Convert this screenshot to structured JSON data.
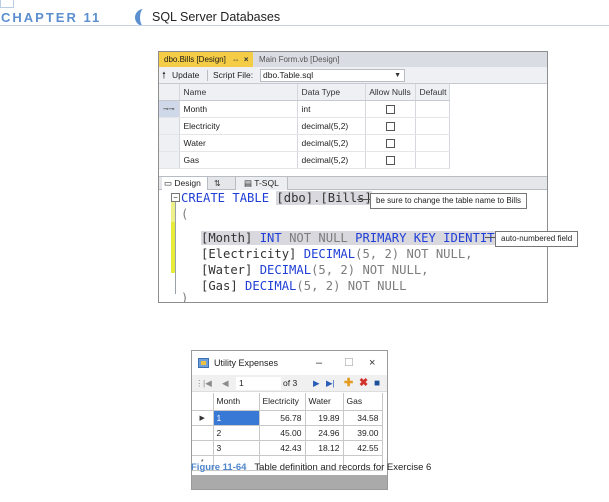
{
  "chapter": {
    "label": "CHAPTER 11",
    "title": "SQL Server Databases"
  },
  "designer": {
    "active_tab": "dbo.Bills [Design]",
    "active_tab_pin": "⇔",
    "active_tab_close": "×",
    "inactive_tab": "Main Form.vb [Design]",
    "toolbar": {
      "update": "Update",
      "script_file_label": "Script File:",
      "script_file_value": "dbo.Table.sql"
    },
    "columns_header": [
      "Name",
      "Data Type",
      "Allow Nulls",
      "Default"
    ],
    "rows": [
      {
        "name": "Month",
        "type": "int",
        "key": true
      },
      {
        "name": "Electricity",
        "type": "decimal(5,2)",
        "key": false
      },
      {
        "name": "Water",
        "type": "decimal(5,2)",
        "key": false
      },
      {
        "name": "Gas",
        "type": "decimal(5,2)",
        "key": false
      }
    ],
    "panel_tabs": {
      "design": "Design",
      "swap": "⇅",
      "tsql": "T-SQL"
    },
    "code": {
      "l1_kw": "CREATE TABLE ",
      "l1_name": "[dbo].[Bills]",
      "l2": "(",
      "l3_a": "[Month] ",
      "l3_b": "INT ",
      "l3_c": "NOT NULL ",
      "l3_d": "PRIMARY KEY IDENTITY",
      "l3_e": ",",
      "l4_a": "[Electricity] ",
      "l4_b": "DECIMAL",
      "l4_c": "(5, 2) ",
      "l4_d": "NOT NULL,",
      "l5_a": "[Water] ",
      "l5_b": "DECIMAL",
      "l5_c": "(5, 2) ",
      "l5_d": "NOT NULL,",
      "l6_a": "[Gas] ",
      "l6_b": "DECIMAL",
      "l6_c": "(5, 2) ",
      "l6_d": "NOT NULL",
      "l7": ")"
    },
    "callouts": {
      "rename": "be sure to change the table name to Bills",
      "identity": "auto-numbered field"
    }
  },
  "form": {
    "title": "Utility Expenses",
    "window_buttons": {
      "minimize": "–",
      "maximize": "☐",
      "close": "×"
    },
    "navigator": {
      "position": "1",
      "of_count": "of 3"
    },
    "grid_header": [
      "Month",
      "Electricity",
      "Water",
      "Gas"
    ],
    "grid_rows": [
      [
        "1",
        "56.78",
        "19.89",
        "34.58"
      ],
      [
        "2",
        "45.00",
        "24.96",
        "39.00"
      ],
      [
        "3",
        "42.43",
        "18.12",
        "42.55"
      ]
    ],
    "new_row_marker": "*",
    "current_row_marker": "▶"
  },
  "caption": {
    "figure": "Figure 11-64",
    "text": "Table definition and records for Exercise 6"
  }
}
